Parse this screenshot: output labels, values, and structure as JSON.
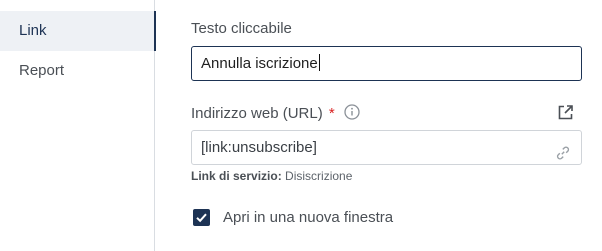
{
  "sidebar": {
    "items": [
      {
        "label": "Link",
        "active": true
      },
      {
        "label": "Report",
        "active": false
      }
    ]
  },
  "form": {
    "link_text": {
      "label": "Testo cliccabile",
      "value": "Annulla iscrizione"
    },
    "url": {
      "label": "Indirizzo web (URL)",
      "required_mark": "*",
      "value": "[link:unsubscribe]"
    },
    "service_link": {
      "label": "Link di servizio:",
      "value": "Disiscrizione"
    },
    "new_window": {
      "label": "Apri in una nuova finestra",
      "checked": true
    }
  },
  "icons": {
    "info": "info-icon",
    "external": "external-link-icon",
    "link": "link-icon",
    "check": "checkmark-icon"
  },
  "colors": {
    "accent": "#1d3354",
    "required": "#d92020",
    "sidebar_active_bg": "#eef1f5"
  }
}
